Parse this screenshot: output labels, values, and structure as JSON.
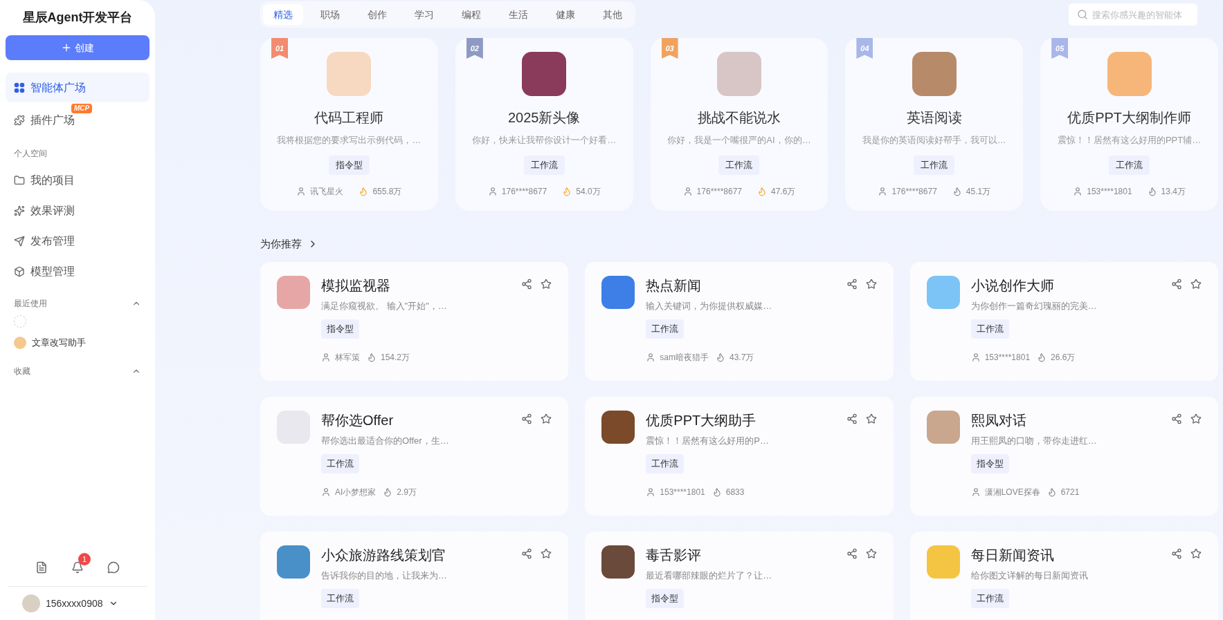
{
  "sidebar": {
    "title": "星辰Agent开发平台",
    "create_button": "创建",
    "nav": [
      {
        "label": "智能体广场",
        "selected": true
      },
      {
        "label": "插件广场",
        "selected": false,
        "badge": "MCP"
      }
    ],
    "personal_label": "个人空间",
    "personal_items": [
      {
        "label": "我的项目",
        "selected": false
      },
      {
        "label": "效果评测",
        "selected": false
      },
      {
        "label": "发布管理",
        "selected": false
      },
      {
        "label": "模型管理",
        "selected": false
      }
    ],
    "recent": {
      "label": "最近使用",
      "expanded": true,
      "items": [
        {
          "kind": "blank"
        },
        {
          "kind": "named",
          "label": "文章改写助手"
        }
      ]
    },
    "favorites": {
      "label": "收藏",
      "expanded": true
    },
    "notification_count": "1",
    "user": "156xxxx0908"
  },
  "tabs": [
    {
      "label": "精选",
      "selected": true
    },
    {
      "label": "职场",
      "selected": false
    },
    {
      "label": "创作",
      "selected": false
    },
    {
      "label": "学习",
      "selected": false
    },
    {
      "label": "编程",
      "selected": false
    },
    {
      "label": "生活",
      "selected": false
    },
    {
      "label": "健康",
      "selected": false
    },
    {
      "label": "其他",
      "selected": false
    }
  ],
  "search": {
    "placeholder": "搜索你感兴趣的智能体"
  },
  "featured": [
    {
      "rank": "01",
      "color": "#f28b6f",
      "title": "代码工程师",
      "description": "我将根据您的要求写出示例代码，…",
      "tag": "指令型",
      "author": "讯飞星火",
      "heat": "655.8万",
      "hot": true
    },
    {
      "rank": "02",
      "color": "#8e99c4",
      "title": "2025新头像",
      "description": "你好，快来让我帮你设计一个好看…",
      "tag": "工作流",
      "author": "176****8677",
      "heat": "54.0万",
      "hot": true
    },
    {
      "rank": "03",
      "color": "#f0a35e",
      "title": "挑战不能说水",
      "description": "你好，我是一个嘴很严的AI，你的…",
      "tag": "工作流",
      "author": "176****8677",
      "heat": "47.6万",
      "hot": true
    },
    {
      "rank": "04",
      "color": "#a9b6e8",
      "title": "英语阅读",
      "description": "我是你的英语阅读好帮手，我可以…",
      "tag": "工作流",
      "author": "176****8677",
      "heat": "45.1万",
      "hot": false
    },
    {
      "rank": "05",
      "color": "#a9b6e8",
      "title": "优质PPT大纲制作师",
      "description": "震惊！！居然有这么好用的PPT辅…",
      "tag": "工作流",
      "author": "153****1801",
      "heat": "13.4万",
      "hot": false
    }
  ],
  "recommend": {
    "title": "为你推荐",
    "items": [
      {
        "title": "模拟监视器",
        "description": "满足你窥视欲。 输入\"开始\"，…",
        "tag": "指令型",
        "author": "林军策",
        "heat": "154.2万"
      },
      {
        "title": "热点新闻",
        "description": "输入关键词，为你提供权威媒…",
        "tag": "工作流",
        "author": "sam暗夜猎手",
        "heat": "43.7万"
      },
      {
        "title": "小说创作大师",
        "description": "为你创作一篇奇幻瑰丽的完美…",
        "tag": "工作流",
        "author": "153****1801",
        "heat": "26.6万"
      },
      {
        "title": "帮你选Offer",
        "description": "帮你选出最适合你的Offer，生…",
        "tag": "工作流",
        "author": "AI小梦想家",
        "heat": "2.9万"
      },
      {
        "title": "优质PPT大纲助手",
        "description": "震惊！！居然有这么好用的P…",
        "tag": "工作流",
        "author": "153****1801",
        "heat": "6833"
      },
      {
        "title": "熙凤对话",
        "description": "用王熙凤的口吻，带你走进红…",
        "tag": "指令型",
        "author": "潇湘LOVE探春",
        "heat": "6721"
      },
      {
        "title": "小众旅游路线策划官",
        "description": "告诉我你的目的地，让我来为…",
        "tag": "工作流"
      },
      {
        "title": "毒舌影评",
        "description": "最近看哪部辣眼的烂片了？让…",
        "tag": "指令型"
      },
      {
        "title": "每日新闻资讯",
        "description": "给你图文详解的每日新闻资讯",
        "tag": "工作流"
      }
    ]
  }
}
